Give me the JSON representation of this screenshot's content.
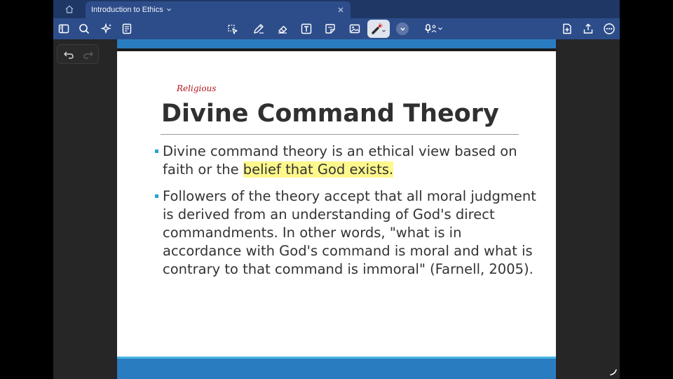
{
  "tabbar": {
    "home_icon": "home-icon",
    "tab": {
      "title": "Introduction to Ethics"
    },
    "close_icon": "close-icon"
  },
  "toolbar": {
    "left_icons": [
      "sidebar-icon",
      "search-icon",
      "sparkle-icon",
      "document-icon"
    ],
    "tool_icons": [
      "lasso-icon",
      "pen-icon",
      "eraser-icon",
      "text-box-icon",
      "sticky-note-icon",
      "image-icon",
      "laser-pointer-icon",
      "color-picker-icon",
      "microphone-icon"
    ],
    "right_icons": [
      "add-page-icon",
      "share-icon",
      "more-icon"
    ]
  },
  "history": {
    "undo_icon": "undo-icon",
    "redo_icon": "redo-icon"
  },
  "slide": {
    "annotation": "Religious",
    "title": "Divine Command Theory",
    "bullets": [
      {
        "text_before": "Divine command theory is an ethical view based on faith or the ",
        "highlight": "belief that God exists.",
        "text_after": ""
      },
      {
        "text_before": "Followers of the theory accept that all moral judgment is derived from an understanding of God's direct commandments. In other words, \"what is in accordance with God's command is moral and what is contrary to that command is immoral\" (Farnell, 2005).",
        "highlight": "",
        "text_after": ""
      }
    ]
  },
  "colors": {
    "tabbar": "#1e3765",
    "toolbar": "#2d4d8a",
    "slide_band": "#2a7cc0",
    "highlight": "#fdf78c",
    "annotation_ink": "#b0141b"
  }
}
